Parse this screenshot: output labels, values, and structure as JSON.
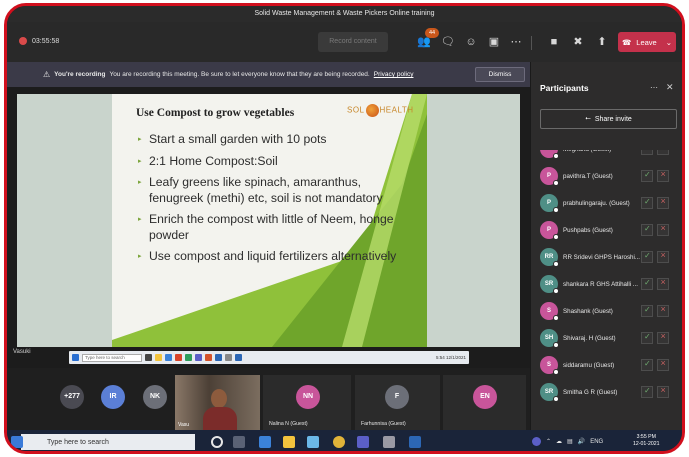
{
  "window": {
    "title": "Solid Waste Management & Waste Pickers Online training"
  },
  "toolbar": {
    "timer": "03:55:58",
    "record_button": "Record content",
    "participants_badge": "44",
    "leave_label": "Leave"
  },
  "banner": {
    "heading": "You're recording",
    "message": "You are recording this meeting. Be sure to let everyone know that they are being recorded.",
    "link": "Privacy policy",
    "dismiss": "Dismiss"
  },
  "slide": {
    "title": "Use Compost to grow vegetables",
    "logo_left": "SOL",
    "logo_right": "HEALTH",
    "bullets": [
      "Start a small garden with 10 pots",
      "2:1  Home Compost:Soil",
      "Leafy greens like spinach, amaranthus, fenugreek (methi) etc, soil is not mandatory",
      "Enrich the compost with little of Neem, honge powder",
      "Use compost and liquid fertilizers alternatively"
    ]
  },
  "stage": {
    "presenter_name": "Vasuki",
    "shared_taskbar_search": "Type here to search",
    "shared_taskbar_time": "5:54",
    "shared_taskbar_date": "12/1/2021"
  },
  "tiles": {
    "overflow_count": "+277",
    "circles": [
      {
        "initials": "IR",
        "color": "#5b7fd6"
      },
      {
        "initials": "NK",
        "color": "#6c6f78"
      },
      {
        "initials": "NN",
        "color": "#c8559a"
      },
      {
        "initials": "F",
        "color": "#6c6f78"
      },
      {
        "initials": "EN",
        "color": "#c8559a"
      }
    ],
    "camera_label": "Vasu",
    "tile_labels": [
      "Nalina N (Guest)",
      "Farhunnisa (Guest)"
    ]
  },
  "panel": {
    "title": "Participants",
    "share_invite": "Share invite",
    "participants": [
      {
        "name": "Meghana (Guest)",
        "initials": "M",
        "color": "#c8559a"
      },
      {
        "name": "pavithra.T (Guest)",
        "initials": "P",
        "color": "#c8559a"
      },
      {
        "name": "prabhulingaraju. (Guest)",
        "initials": "P",
        "color": "#4f8f86"
      },
      {
        "name": "Pushpabs (Guest)",
        "initials": "P",
        "color": "#c8559a"
      },
      {
        "name": "RR Sridevi GHPS Haroshi...",
        "initials": "RR",
        "color": "#4f8f86"
      },
      {
        "name": "shankara R GHS Attihalli ...",
        "initials": "SR",
        "color": "#4f8f86"
      },
      {
        "name": "Shashank (Guest)",
        "initials": "S",
        "color": "#c8559a"
      },
      {
        "name": "Shivaraj. H (Guest)",
        "initials": "SH",
        "color": "#4f8f86"
      },
      {
        "name": "siddaramu (Guest)",
        "initials": "S",
        "color": "#c8559a"
      },
      {
        "name": "Smitha G R (Guest)",
        "initials": "SR",
        "color": "#4f8f86"
      }
    ]
  },
  "taskbar": {
    "search_placeholder": "Type here to search",
    "tray_lang": "ENG",
    "time": "3:55 PM",
    "date": "12-01-2021"
  }
}
